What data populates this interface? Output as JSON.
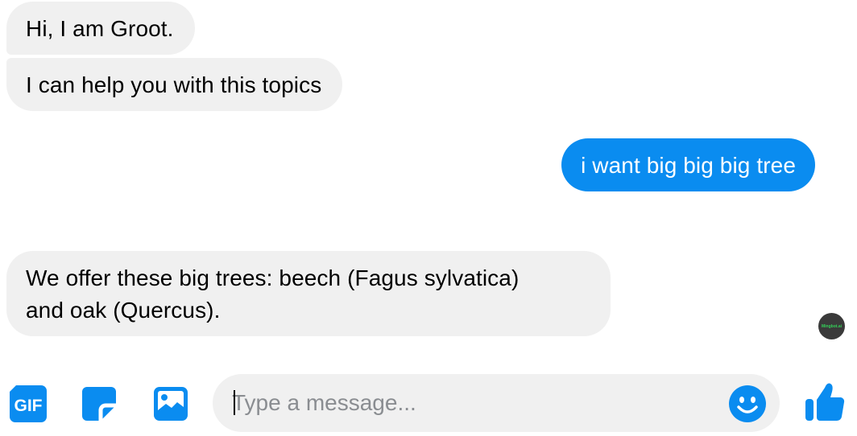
{
  "messages": [
    {
      "direction": "incoming",
      "text": "Hi, I am Groot."
    },
    {
      "direction": "incoming",
      "text": "I can help you with this topics"
    },
    {
      "direction": "outgoing",
      "text": "i want big big big tree"
    },
    {
      "direction": "incoming",
      "lines": [
        "We offer these big trees: beech (Fagus sylvatica)",
        "and oak (Quercus)."
      ]
    }
  ],
  "bot_badge": {
    "text": "Mingbot.ai",
    "color": "#34d058"
  },
  "composer": {
    "placeholder": "Type a message...",
    "value": "",
    "gif_label": "GIF",
    "icons": [
      "gif-icon",
      "sticker-icon",
      "image-icon",
      "emoji-icon",
      "thumbs-up-icon"
    ]
  },
  "colors": {
    "accent": "#0a8cf0",
    "incoming_bubble": "#f0f0f0",
    "input_background": "#f0f0f0",
    "placeholder_text": "#8a8d91"
  }
}
